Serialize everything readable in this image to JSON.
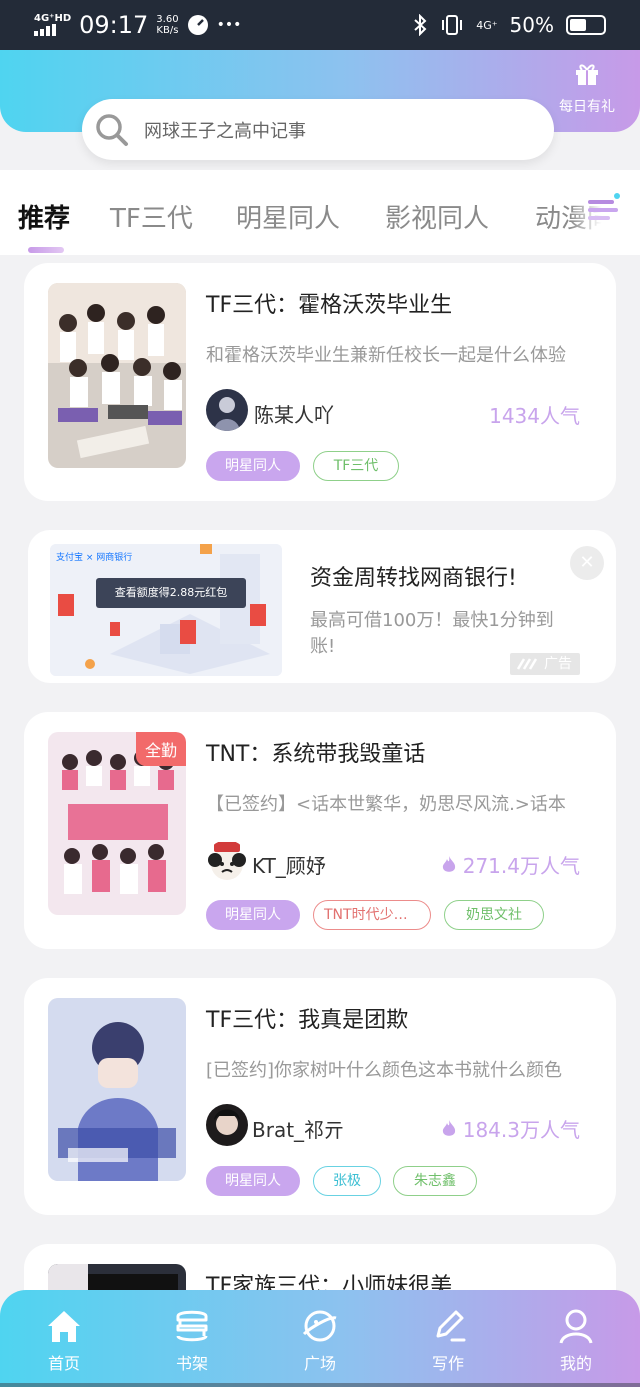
{
  "status_bar": {
    "network": "4G⁺HD",
    "time": "09:17",
    "speed_value": "3.60",
    "speed_unit": "KB/s",
    "more": "•••",
    "network2": "4G⁺",
    "battery": "50%"
  },
  "header": {
    "gift_label": "每日有礼",
    "search_text": "网球王子之高中记事"
  },
  "tabs": [
    "推荐",
    "TF三代",
    "明星同人",
    "影视同人",
    "动漫同人"
  ],
  "books": [
    {
      "title": "TF三代：霍格沃茨毕业生",
      "desc": "和霍格沃茨毕业生兼新任校长一起是什么体验",
      "author": "陈某人吖",
      "popularity": "1434人气",
      "tags": [
        "明星同人",
        "TF三代"
      ]
    },
    {
      "title": "TNT：系统带我毁童话",
      "desc": "【已签约】<话本世繁华，奶思尽风流.>话本",
      "author": "KT_顾妤",
      "popularity": "271.4万人气",
      "tags": [
        "明星同人",
        "TNT时代少年团",
        "奶思文社"
      ],
      "badge": "全勤"
    },
    {
      "title": "TF三代：我真是团欺",
      "desc": "[已签约]你家树叶什么颜色这本书就什么颜色",
      "author": "Brat_祁亓",
      "popularity": "184.3万人气",
      "tags": [
        "明星同人",
        "张极",
        "朱志鑫"
      ]
    },
    {
      "title": "TF家族三代：小师妹很美"
    }
  ],
  "ad": {
    "banner_text": "查看额度得2.88元红包",
    "brand": "支付宝 × 网商银行",
    "title": "资金周转找网商银行!",
    "desc": "最高可借100万！最快1分钟到账!",
    "close": "✕",
    "label": "广告"
  },
  "bottom_nav": [
    "首页",
    "书架",
    "广场",
    "写作",
    "我的"
  ]
}
